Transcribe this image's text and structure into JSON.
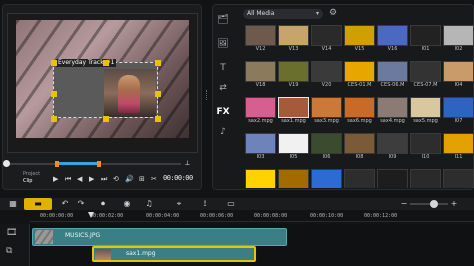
{
  "player": {
    "overlay_label": "Everyday Track #1",
    "mode": {
      "project": "Project",
      "clip": "Clip"
    },
    "timecode": "00:00:00"
  },
  "library": {
    "dropdown_selected": "All Media",
    "thumbnails": [
      {
        "label": "V12",
        "selected": false
      },
      {
        "label": "V13",
        "selected": false
      },
      {
        "label": "V14",
        "selected": false
      },
      {
        "label": "V15",
        "selected": false
      },
      {
        "label": "V16",
        "selected": false
      },
      {
        "label": "I01",
        "selected": false
      },
      {
        "label": "I02",
        "selected": false
      },
      {
        "label": "V18",
        "selected": false
      },
      {
        "label": "V19",
        "selected": false
      },
      {
        "label": "V20",
        "selected": false
      },
      {
        "label": "CES-01.M",
        "selected": false
      },
      {
        "label": "CES-06.M",
        "selected": false
      },
      {
        "label": "CES-07.M",
        "selected": false
      },
      {
        "label": "I04",
        "selected": false
      },
      {
        "label": "sax2.mpg",
        "selected": false
      },
      {
        "label": "sax1.mpg",
        "selected": true
      },
      {
        "label": "sax3.mpg",
        "selected": false
      },
      {
        "label": "sax6.mpg",
        "selected": false
      },
      {
        "label": "sax4.mpg",
        "selected": false
      },
      {
        "label": "sax5.mpg",
        "selected": false
      },
      {
        "label": "I07",
        "selected": false
      },
      {
        "label": "I03",
        "selected": false
      },
      {
        "label": "I05",
        "selected": false
      },
      {
        "label": "I06",
        "selected": false
      },
      {
        "label": "I08",
        "selected": false
      },
      {
        "label": "I09",
        "selected": false
      },
      {
        "label": "I10",
        "selected": false
      },
      {
        "label": "I11",
        "selected": false
      },
      {
        "label": "",
        "selected": false
      },
      {
        "label": "",
        "selected": false
      },
      {
        "label": "",
        "selected": false
      },
      {
        "label": "",
        "selected": false
      },
      {
        "label": "",
        "selected": false
      },
      {
        "label": "",
        "selected": false
      },
      {
        "label": "",
        "selected": false
      }
    ]
  },
  "timeline": {
    "ruler_ticks": [
      "00:00:00:00",
      "00:00:02:00",
      "00:00:04:00",
      "00:00:06:00",
      "00:00:08:00",
      "00:00:10:00",
      "00:00:12:00"
    ],
    "tracks": [
      {
        "clip_label": "MUSICS.JPG"
      },
      {
        "clip_label": "sax1.mpg"
      }
    ]
  }
}
